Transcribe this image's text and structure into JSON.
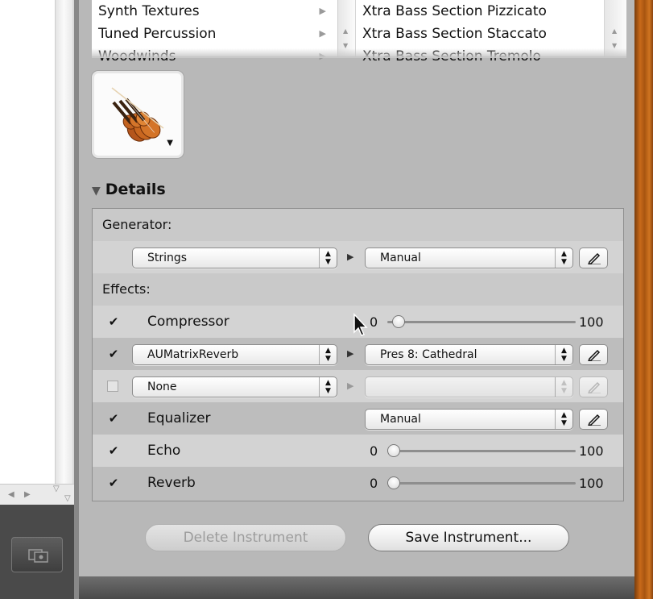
{
  "browser": {
    "categories": [
      "Synth Textures",
      "Tuned Percussion",
      "Woodwinds"
    ],
    "instruments": [
      "Xtra Bass Section Pizzicato",
      "Xtra Bass Section Staccato",
      "Xtra Bass Section Tremolo"
    ]
  },
  "details": {
    "title": "Details",
    "generator_label": "Generator:",
    "generator": {
      "instrument": "Strings",
      "preset": "Manual"
    },
    "effects_label": "Effects:",
    "effects": [
      {
        "name": "Compressor",
        "checked": true,
        "type": "slider",
        "min": "0",
        "max": "100",
        "value_fraction": 0.05
      },
      {
        "name": "AUMatrixReverb",
        "checked": true,
        "type": "popup",
        "preset": "Pres 8: Cathedral"
      },
      {
        "name": "None",
        "checked": false,
        "type": "popup",
        "preset": ""
      },
      {
        "name": "Equalizer",
        "checked": true,
        "type": "preset",
        "preset": "Manual"
      },
      {
        "name": "Echo",
        "checked": true,
        "type": "slider",
        "min": "0",
        "max": "100",
        "value_fraction": 0.0
      },
      {
        "name": "Reverb",
        "checked": true,
        "type": "slider",
        "min": "0",
        "max": "100",
        "value_fraction": 0.0
      }
    ]
  },
  "buttons": {
    "delete": "Delete Instrument",
    "save": "Save Instrument..."
  },
  "icons": {
    "instrument": "violin-icon",
    "pencil": "pencil-icon"
  }
}
